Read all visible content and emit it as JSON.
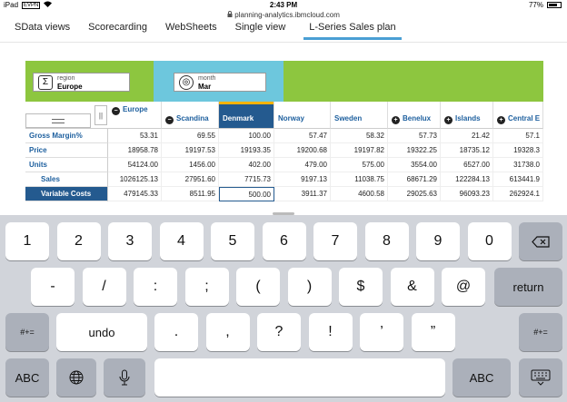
{
  "status": {
    "device": "iPad",
    "carrier": "EVPN",
    "time": "2:43 PM",
    "battery": "77%",
    "battery_level": 0.77
  },
  "url": "planning-analytics.ibmcloud.com",
  "tabs": [
    "SData views",
    "Scorecarding",
    "WebSheets",
    "Single view",
    "L-Series Sales plan"
  ],
  "active_tab": 4,
  "context": {
    "region": {
      "dimension": "region",
      "member": "Europe"
    },
    "month": {
      "dimension": "month",
      "member": "Mar"
    }
  },
  "grid": {
    "columns": [
      "Europe",
      "Scandina",
      "Denmark",
      "Norway",
      "Sweden",
      "Benelux",
      "Islands",
      "Central E"
    ],
    "rows": [
      "Gross Margin%",
      "Price",
      "Units",
      "Sales",
      "Variable Costs"
    ],
    "values": [
      [
        "53.31",
        "69.55",
        "100.00",
        "57.47",
        "58.32",
        "57.73",
        "21.42",
        "57.1"
      ],
      [
        "18958.78",
        "19197.53",
        "19193.35",
        "19200.68",
        "19197.82",
        "19322.25",
        "18735.12",
        "19328.3"
      ],
      [
        "54124.00",
        "1456.00",
        "402.00",
        "479.00",
        "575.00",
        "3554.00",
        "6527.00",
        "31738.0"
      ],
      [
        "1026125.13",
        "27951.60",
        "7715.73",
        "9197.13",
        "11038.75",
        "68671.29",
        "122284.13",
        "613441.9"
      ],
      [
        "479145.33",
        "8511.95",
        "500.00",
        "3911.37",
        "4600.58",
        "29025.63",
        "96093.23",
        "262924.1"
      ]
    ]
  },
  "keyboard": {
    "row1": [
      "1",
      "2",
      "3",
      "4",
      "5",
      "6",
      "7",
      "8",
      "9",
      "0"
    ],
    "row2": [
      "-",
      "/",
      ":",
      ";",
      "(",
      ")",
      "$",
      "&",
      "@"
    ],
    "return": "return",
    "row3": [
      "undo",
      ".",
      ",",
      "?",
      "!",
      "’",
      "”"
    ],
    "shift_label": "#+=",
    "abc_label": "ABC"
  }
}
